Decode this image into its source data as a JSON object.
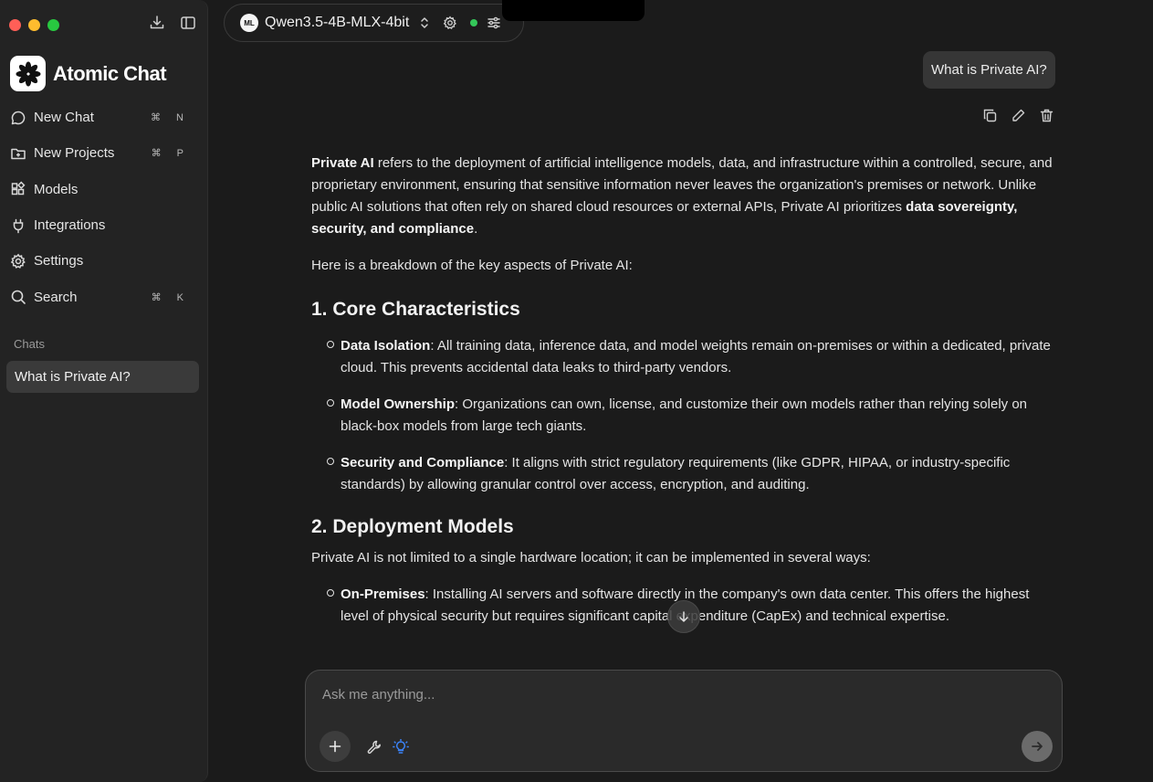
{
  "window": {
    "controls": [
      "close",
      "minimize",
      "zoom"
    ]
  },
  "sidebar": {
    "top_icons": [
      "download-icon",
      "sidebar-toggle-icon"
    ],
    "brand": {
      "name": "Atomic Chat"
    },
    "items": [
      {
        "label": "New Chat",
        "icon": "chat-bubble-icon",
        "shortcut": "⌘ N"
      },
      {
        "label": "New Projects",
        "icon": "folder-plus-icon",
        "shortcut": "⌘ P"
      },
      {
        "label": "Models",
        "icon": "grid-icon",
        "shortcut": ""
      },
      {
        "label": "Integrations",
        "icon": "plug-icon",
        "shortcut": ""
      },
      {
        "label": "Settings",
        "icon": "gear-icon",
        "shortcut": ""
      },
      {
        "label": "Search",
        "icon": "search-icon",
        "shortcut": "⌘ K"
      }
    ],
    "chats_heading": "Chats",
    "chats": [
      {
        "title": "What is Private AI?",
        "active": true
      }
    ]
  },
  "header": {
    "model_badge": "ML",
    "model_name": "Qwen3.5-4B-MLX-4bit",
    "status": "online",
    "status_color": "#34c759"
  },
  "conversation": {
    "user_message": "What is Private AI?",
    "message_actions": [
      "copy-icon",
      "edit-icon",
      "trash-icon"
    ],
    "answer": {
      "intro_bold": "Private AI",
      "intro_text": " refers to the deployment of artificial intelligence models, data, and infrastructure within a controlled, secure, and proprietary environment, ensuring that sensitive information never leaves the organization's premises or network. Unlike public AI solutions that often rely on shared cloud resources or external APIs, Private AI prioritizes ",
      "intro_bold_end": "data sovereignty, security, and compliance",
      "intro_end": ".",
      "breakdown": "Here is a breakdown of the key aspects of Private AI:",
      "section1_title": "1. Core Characteristics",
      "section1_items": [
        {
          "term": "Data Isolation",
          "text": ": All training data, inference data, and model weights remain on-premises or within a dedicated, private cloud. This prevents accidental data leaks to third-party vendors."
        },
        {
          "term": "Model Ownership",
          "text": ": Organizations can own, license, and customize their own models rather than relying solely on black-box models from large tech giants."
        },
        {
          "term": "Security and Compliance",
          "text": ": It aligns with strict regulatory requirements (like GDPR, HIPAA, or industry-specific standards) by allowing granular control over access, encryption, and auditing."
        }
      ],
      "section2_title": "2. Deployment Models",
      "section2_intro": "Private AI is not limited to a single hardware location; it can be implemented in several ways:",
      "section2_items": [
        {
          "term": "On-Premises",
          "text": ": Installing AI servers and software directly in the company's own data center. This offers the highest level of physical security but requires significant capital expenditure (CapEx) and technical expertise."
        }
      ]
    }
  },
  "composer": {
    "placeholder": "Ask me anything...",
    "value": "",
    "tools": [
      "plus-icon",
      "wrench-icon",
      "lightbulb-icon",
      "send-arrow-icon"
    ],
    "accent": "#3b82f6"
  }
}
